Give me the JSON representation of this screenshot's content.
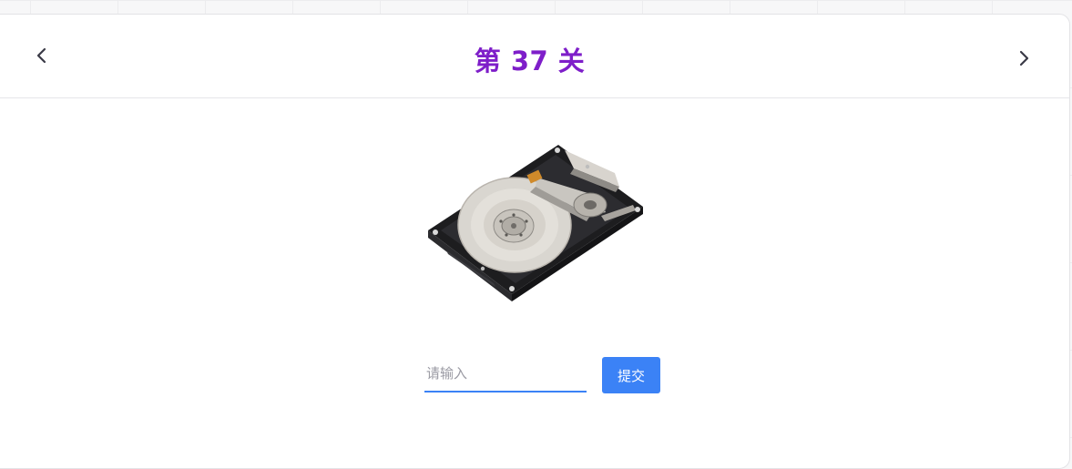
{
  "header": {
    "title": "第 37 关",
    "prev_icon": "chevron-left-icon",
    "next_icon": "chevron-right-icon",
    "title_color": "#7e1ec9"
  },
  "puzzle": {
    "image": "hard-disk-drive"
  },
  "answer": {
    "value": "",
    "placeholder": "请输入",
    "submit_label": "提交",
    "accent_color": "#3b82f6"
  }
}
